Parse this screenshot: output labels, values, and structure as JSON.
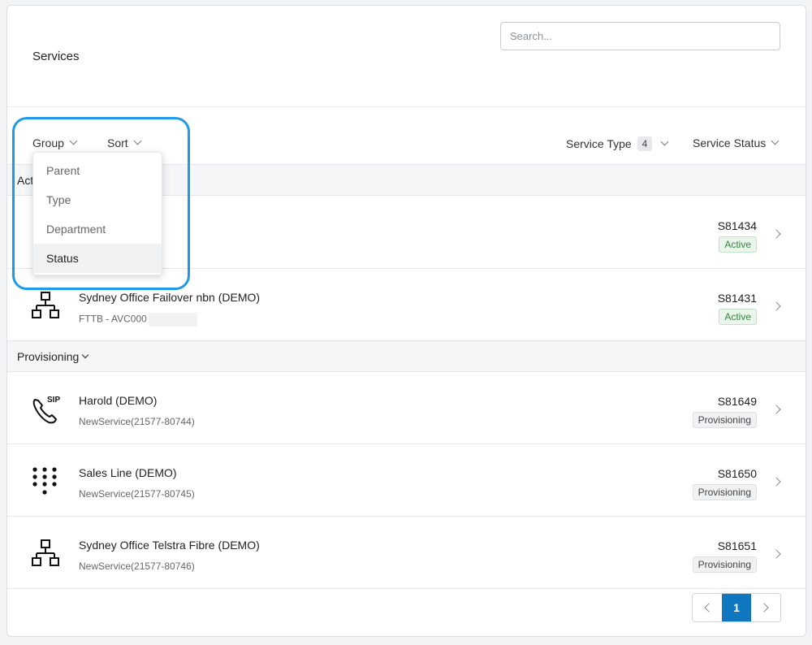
{
  "header": {
    "title": "Services",
    "search_placeholder": "Search..."
  },
  "toolbar": {
    "group_label": "Group",
    "sort_label": "Sort",
    "service_type_label": "Service Type",
    "service_type_count": "4",
    "service_status_label": "Service Status"
  },
  "group_menu": {
    "items": [
      "Parent",
      "Type",
      "Department",
      "Status"
    ],
    "selected": "Status"
  },
  "groups": [
    {
      "label": "Active",
      "label_visible": "Acti",
      "rows": [
        {
          "name": "",
          "sub": "",
          "id": "S81434",
          "status": "Active",
          "icon": "unknown-icon"
        },
        {
          "name": "Sydney Office Failover nbn (DEMO)",
          "sub": "FTTB - AVC000",
          "id": "S81431",
          "status": "Active",
          "icon": "network-icon"
        }
      ]
    },
    {
      "label": "Provisioning",
      "rows": [
        {
          "name": "Harold (DEMO)",
          "sub": "NewService(21577-80744)",
          "id": "S81649",
          "status": "Provisioning",
          "icon": "sip-phone-icon"
        },
        {
          "name": "Sales Line (DEMO)",
          "sub": "NewService(21577-80745)",
          "id": "S81650",
          "status": "Provisioning",
          "icon": "dialpad-icon"
        },
        {
          "name": "Sydney Office Telstra Fibre (DEMO)",
          "sub": "NewService(21577-80746)",
          "id": "S81651",
          "status": "Provisioning",
          "icon": "network-icon"
        }
      ]
    }
  ],
  "pagination": {
    "current": "1"
  },
  "colors": {
    "accent": "#0f77c0",
    "highlight": "#1e9be6",
    "active_text": "#2e8b3d"
  }
}
